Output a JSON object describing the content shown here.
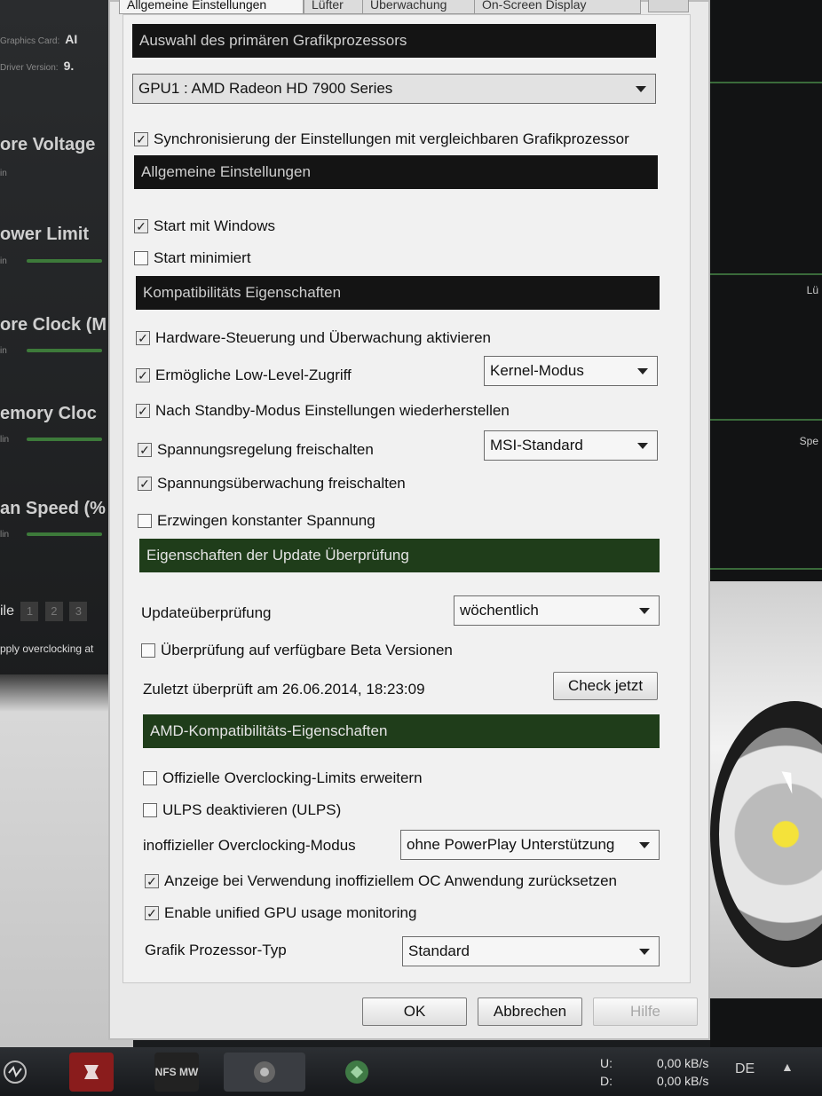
{
  "background_left": {
    "meta1_label": "Graphics Card:",
    "meta1_value": "AI",
    "meta2_label": "Driver Version:",
    "meta2_value": "9.",
    "sliders": [
      {
        "label": "ore Voltage",
        "min": "in"
      },
      {
        "label": "ower Limit",
        "min": "in"
      },
      {
        "label": "ore Clock (M",
        "min": "in"
      },
      {
        "label": "emory Cloc",
        "min": "lin"
      },
      {
        "label": "an Speed (%",
        "min": "lin"
      }
    ],
    "profile_label": "ile",
    "profile_slots": [
      "1",
      "2",
      "3"
    ],
    "apply_text": "pply overclocking at"
  },
  "background_right": {
    "label1": "Lü",
    "label2": "Spe"
  },
  "dialog": {
    "tabs": [
      "Allgemeine Einstellungen",
      "Lüfter",
      "Überwachung",
      "On-Screen Display"
    ],
    "sec_gpu": "Auswahl des primären Grafikprozessors",
    "gpu_select": "GPU1 : AMD Radeon HD 7900 Series",
    "sync_label": "Synchronisierung der Einstellungen mit vergleichbaren Grafikprozessor",
    "sec_general": "Allgemeine Einstellungen",
    "start_windows": "Start mit Windows",
    "start_min": "Start minimiert",
    "sec_compat": "Kompatibilitäts Eigenschaften",
    "hw_control": "Hardware-Steuerung und Überwachung aktivieren",
    "low_level": "Ermögliche Low-Level-Zugriff",
    "low_level_mode": "Kernel-Modus",
    "standby": "Nach Standby-Modus Einstellungen wiederherstellen",
    "voltage_unlock": "Spannungsregelung freischalten",
    "voltage_mode": "MSI-Standard",
    "voltage_monitor": "Spannungsüberwachung freischalten",
    "constant_voltage": "Erzwingen konstanter Spannung",
    "sec_update": "Eigenschaften der Update Überprüfung",
    "update_check_label": "Updateüberprüfung",
    "update_interval": "wöchentlich",
    "beta_check": "Überprüfung auf verfügbare Beta Versionen",
    "last_checked": "Zuletzt überprüft am 26.06.2014, 18:23:09",
    "check_now": "Check jetzt",
    "sec_amd": "AMD-Kompatibilitäts-Eigenschaften",
    "official_oc": "Offizielle Overclocking-Limits erweitern",
    "ulps": "ULPS deaktivieren (ULPS)",
    "unofficial_oc_label": "inoffizieller Overclocking-Modus",
    "unofficial_oc_mode": "ohne PowerPlay Unterstützung",
    "reset_display": "Anzeige bei Verwendung inoffiziellem OC Anwendung zurücksetzen",
    "unified_gpu": "Enable unified GPU usage monitoring",
    "gpu_type_label": "Grafik Prozessor-Typ",
    "gpu_type": "Standard",
    "ok": "OK",
    "cancel": "Abbrechen",
    "help": "Hilfe",
    "checked": {
      "sync": true,
      "start_windows": true,
      "start_min": false,
      "hw_control": true,
      "low_level": true,
      "standby": true,
      "voltage_unlock": true,
      "voltage_monitor": true,
      "constant_voltage": false,
      "beta_check": false,
      "official_oc": false,
      "ulps": false,
      "reset_display": true,
      "unified_gpu": true
    }
  },
  "taskbar": {
    "apps": [
      "MSI Afterburner",
      "Wolfenstein",
      "NFS MW",
      "Media Player",
      "Jabber"
    ],
    "nfs_label": "NFS MW",
    "upload_label": "U:",
    "download_label": "D:",
    "upload_rate": "0,00 kB/s",
    "download_rate": "0,00 kB/s",
    "language": "DE"
  },
  "colors": {
    "section_dark": "#141414",
    "section_green": "#1f3d1a",
    "dialog_bg": "#e9e9e9"
  }
}
